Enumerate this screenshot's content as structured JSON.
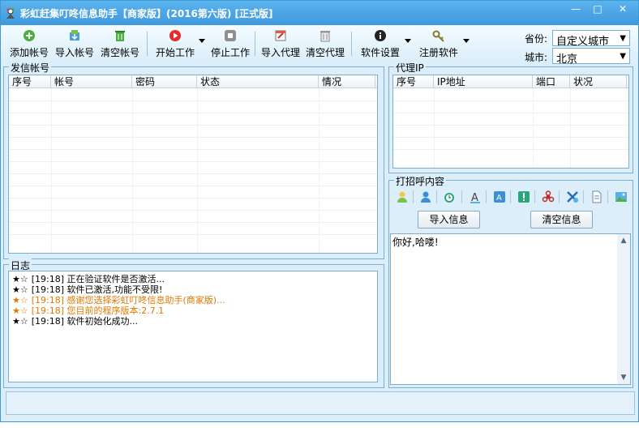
{
  "window": {
    "title": "彩虹赶集叮咚信息助手【商家版】(2016第六版) [正式版]",
    "controls": [
      "—",
      "□",
      "✕"
    ]
  },
  "toolbar": {
    "add_account": "添加帐号",
    "import_account": "导入帐号",
    "clear_account": "清空帐号",
    "start_work": "开始工作",
    "stop_work": "停止工作",
    "import_proxy": "导入代理",
    "clear_proxy": "清空代理",
    "settings": "软件设置",
    "register": "注册软件"
  },
  "location": {
    "province_label": "省份:",
    "province_value": "自定义城市",
    "city_label": "城市:",
    "city_value": "北京"
  },
  "accounts": {
    "legend": "发信帐号",
    "columns": [
      "序号",
      "帐号",
      "密码",
      "状态",
      "情况"
    ]
  },
  "proxy": {
    "legend": "代理IP",
    "columns": [
      "序号",
      "IP地址",
      "端口",
      "状况"
    ]
  },
  "log": {
    "legend": "日志",
    "entries": [
      {
        "stars": "★☆",
        "text": "[19:18] 正在验证软件是否激活...",
        "color": "#000000"
      },
      {
        "stars": "★☆",
        "text": "[19:18] 软件已激活,功能不受限!",
        "color": "#000000"
      },
      {
        "stars": "★☆",
        "text": "[19:18] 感谢您选择彩虹叮咚信息助手(商家版)...",
        "color": "#e07800"
      },
      {
        "stars": "★☆",
        "text": "[19:18] 您目前的程序版本:2.7.1",
        "color": "#e07800"
      },
      {
        "stars": "★☆",
        "text": "[19:18] 软件初始化成功...",
        "color": "#000000"
      }
    ]
  },
  "greeting": {
    "legend": "打招呼内容",
    "import_btn": "导入信息",
    "clear_btn": "清空信息",
    "content": "你好,哈喽!"
  },
  "colors": {
    "title_bar": "#4aa3e4",
    "window_bg": "#dbeefa",
    "border": "#7aaed3"
  }
}
